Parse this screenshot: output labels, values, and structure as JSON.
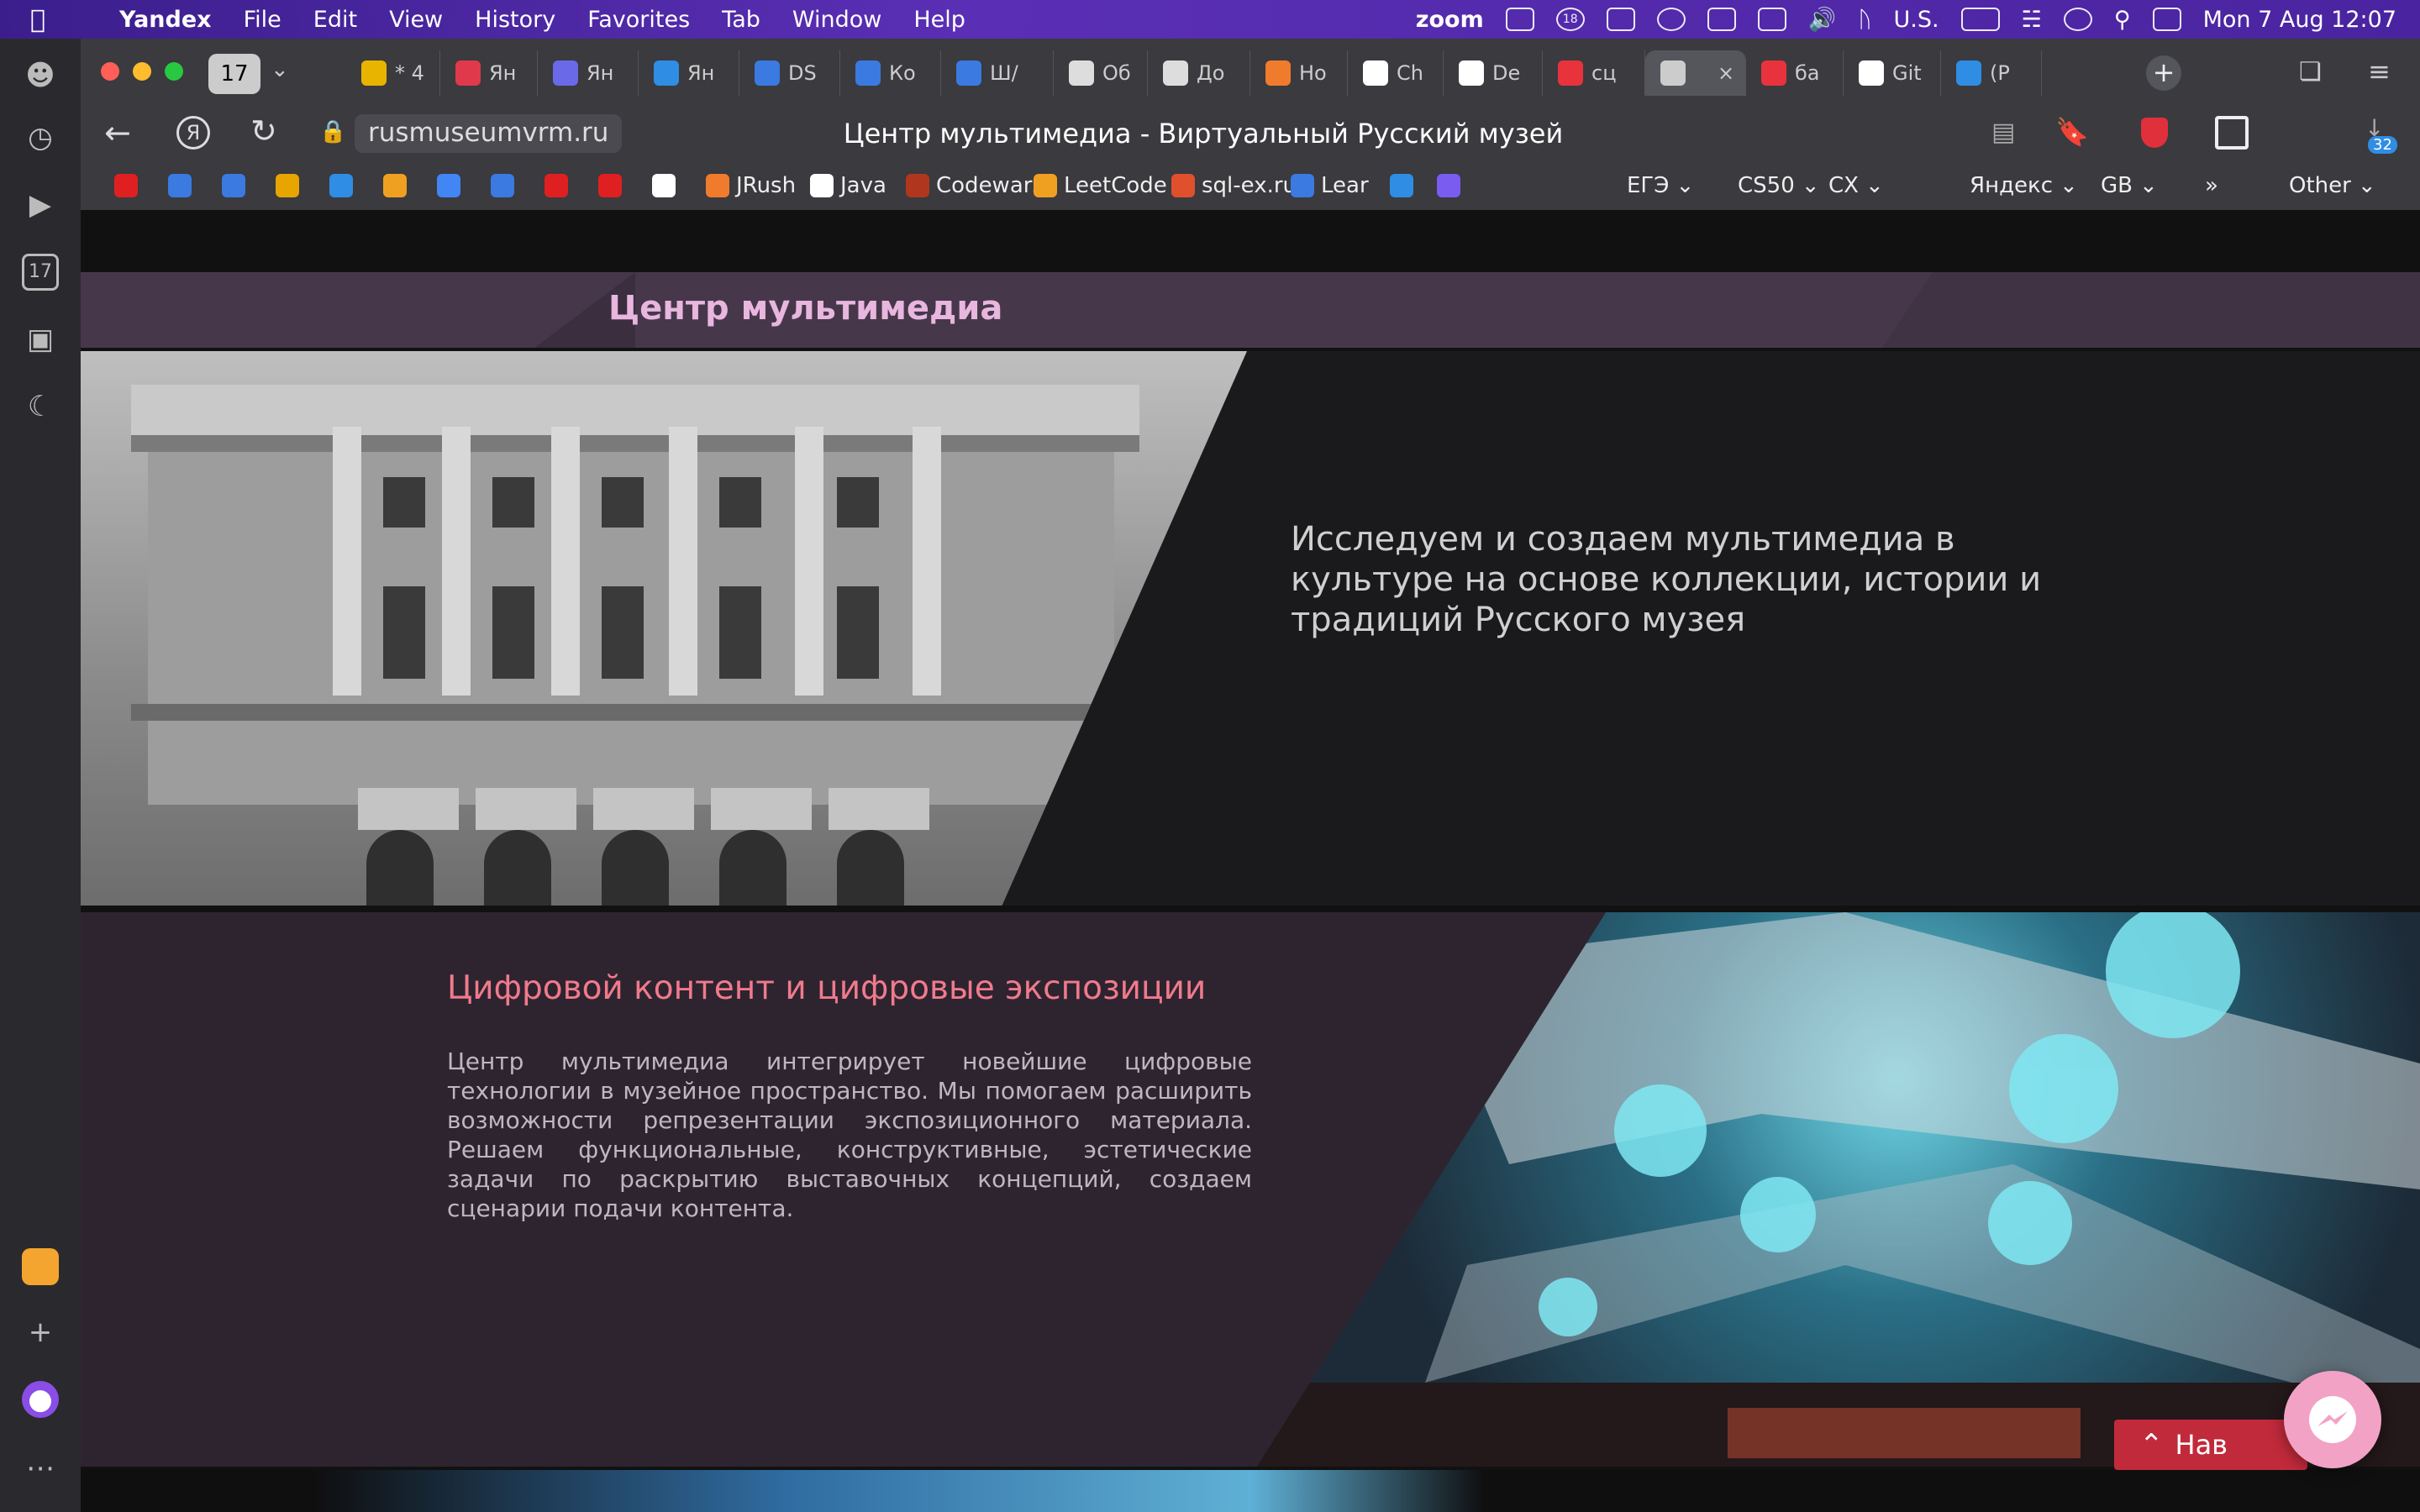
{
  "menubar": {
    "app": "Yandex",
    "items": [
      "File",
      "Edit",
      "View",
      "History",
      "Favorites",
      "Tab",
      "Window",
      "Help"
    ],
    "right_text": "zoom",
    "badge": "18",
    "input_source": "U.S.",
    "datetime": "Mon 7 Aug  12:07"
  },
  "browser": {
    "tab_counter": "17",
    "tabs": [
      {
        "label": "* 4",
        "color": "#e8b400"
      },
      {
        "label": "Ян",
        "color": "#e0394b"
      },
      {
        "label": "Ян",
        "color": "#6a6ae8"
      },
      {
        "label": "Ян",
        "color": "#2f8de4"
      },
      {
        "label": "DS",
        "color": "#3b7ae0"
      },
      {
        "label": "Ко",
        "color": "#3b7ae0"
      },
      {
        "label": "Ш/",
        "color": "#3b7ae0"
      },
      {
        "label": "Об",
        "color": "#dddddd"
      },
      {
        "label": "До",
        "color": "#dddddd"
      },
      {
        "label": "Но",
        "color": "#f07b2d"
      },
      {
        "label": "Ch",
        "color": "#ffffff"
      },
      {
        "label": "De",
        "color": "#ffffff"
      },
      {
        "label": "сц",
        "color": "#e8333c"
      },
      {
        "label": "",
        "color": "#cccccc",
        "active": true
      },
      {
        "label": "ба",
        "color": "#e8333c"
      },
      {
        "label": "Git",
        "color": "#ffffff"
      },
      {
        "label": "(Р",
        "color": "#2f8de4"
      }
    ],
    "url": "rusmuseumvrm.ru",
    "page_title": "Центр мультимедиа - Виртуальный Русский музей",
    "downloads_badge": "32",
    "bookmarks": [
      {
        "label": "",
        "color": "#e02020"
      },
      {
        "label": "",
        "color": "#3b7ae0"
      },
      {
        "label": "",
        "color": "#3b7ae0"
      },
      {
        "label": "",
        "color": "#e8a400"
      },
      {
        "label": "",
        "color": "#2f8de4"
      },
      {
        "label": "",
        "color": "#f0a020"
      },
      {
        "label": "",
        "color": "#4285f4"
      },
      {
        "label": "",
        "color": "#3b7ae0"
      },
      {
        "label": "",
        "color": "#e02020"
      },
      {
        "label": "",
        "color": "#e02020"
      },
      {
        "label": "",
        "color": "#ffffff"
      },
      {
        "label": "JRush",
        "color": "#f07b2d"
      },
      {
        "label": "Java",
        "color": "#ffffff"
      },
      {
        "label": "Codewars",
        "color": "#b1361e"
      },
      {
        "label": "LeetCode",
        "color": "#f0a020"
      },
      {
        "label": "sql-ex.ru",
        "color": "#e0502d"
      },
      {
        "label": "Lear",
        "color": "#3b7ae0"
      },
      {
        "label": "",
        "color": "#2f8de4"
      },
      {
        "label": "",
        "color": "#7b5cf0"
      }
    ],
    "bookmark_folders": [
      "ЕГЭ",
      "CS50",
      "СХ",
      "Яндекс",
      "GB"
    ],
    "other_label": "Other"
  },
  "page": {
    "banner_title": "Центр мультимедиа",
    "intro_text": "Исследуем и создаем мультимедиа в культуре на основе коллекции, истории и традиций Русского музея",
    "section_title": "Цифровой контент и цифровые экспозиции",
    "section_body": "Центр мультимедиа интегрирует новейшие цифровые технологии в музейное пространство. Мы помогаем расширить возможности репрезентации экспозиционного материала. Решаем функциональные, конструктивные, эстетические задачи по раскрытию выставочных концепций, создаем сценарии подачи контента.",
    "nav_button": "Нав",
    "colors": {
      "accent_pink": "#e8b6df",
      "accent_red": "#f07a8c",
      "banner": "#46384a"
    }
  }
}
